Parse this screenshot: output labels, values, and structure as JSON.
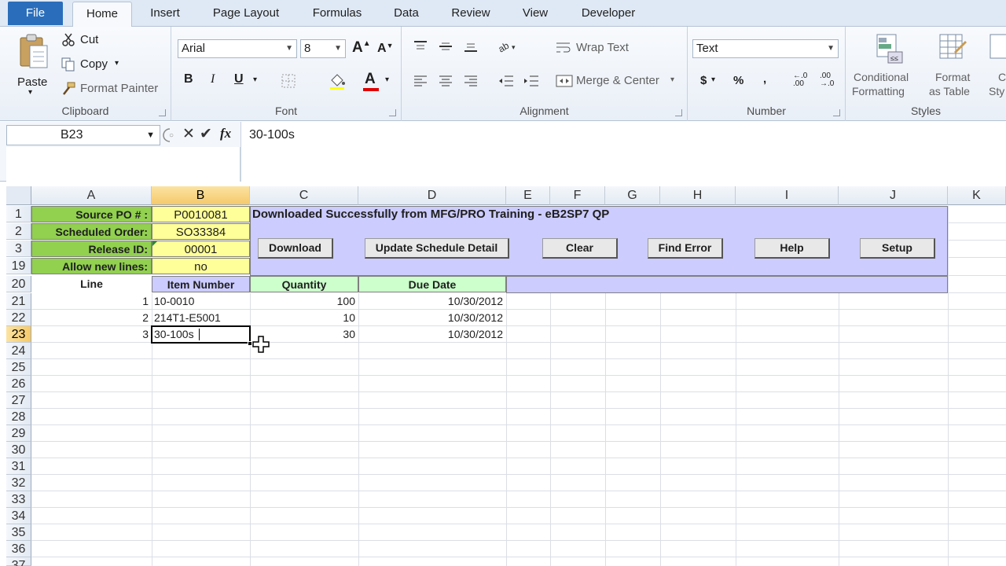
{
  "tabs": [
    {
      "label": "File"
    },
    {
      "label": "Home"
    },
    {
      "label": "Insert"
    },
    {
      "label": "Page Layout"
    },
    {
      "label": "Formulas"
    },
    {
      "label": "Data"
    },
    {
      "label": "Review"
    },
    {
      "label": "View"
    },
    {
      "label": "Developer"
    }
  ],
  "ribbon": {
    "clipboard": {
      "label": "Clipboard",
      "paste": "Paste",
      "cut": "Cut",
      "copy": "Copy",
      "format_painter": "Format Painter"
    },
    "font": {
      "label": "Font",
      "font_name": "Arial",
      "font_size": "8"
    },
    "alignment": {
      "label": "Alignment",
      "wrap_text": "Wrap Text",
      "merge_center": "Merge & Center"
    },
    "number": {
      "label": "Number",
      "format": "Text"
    },
    "styles": {
      "label": "Styles",
      "conditional_1": "Conditional",
      "conditional_2": "Formatting",
      "format_table_1": "Format",
      "format_table_2": "as Table",
      "cell_styles_1": "C",
      "cell_styles_2": "Sty"
    }
  },
  "formula_bar": {
    "name_box": "B23",
    "content": "30-100s"
  },
  "columns": [
    "A",
    "B",
    "C",
    "D",
    "E",
    "F",
    "G",
    "H",
    "I",
    "J",
    "K"
  ],
  "rows": [
    "1",
    "2",
    "3",
    "19",
    "20",
    "21",
    "22",
    "23",
    "24",
    "25",
    "26",
    "27",
    "28",
    "29",
    "30",
    "31",
    "32",
    "33",
    "34",
    "35",
    "36",
    "37"
  ],
  "sheet": {
    "labels": {
      "source_po": "Source PO # :",
      "scheduled_order": "Scheduled Order:",
      "release_id": "Release ID:",
      "allow_new_lines": "Allow new lines:"
    },
    "values": {
      "source_po": "P0010081",
      "scheduled_order": "SO33384",
      "release_id": "00001",
      "allow_new_lines": "no"
    },
    "status_message": "Downloaded Successfully from MFG/PRO Training - eB2SP7 QP",
    "buttons": [
      "Download",
      "Update Schedule Detail",
      "Clear",
      "Find Error",
      "Help",
      "Setup"
    ],
    "headers": {
      "line": "Line",
      "item_number": "Item Number",
      "quantity": "Quantity",
      "due_date": "Due Date"
    },
    "lines": [
      {
        "line": "1",
        "item": "10-0010",
        "qty": "100",
        "due": "10/30/2012"
      },
      {
        "line": "2",
        "item": "214T1-E5001",
        "qty": "10",
        "due": "10/30/2012"
      },
      {
        "line": "3",
        "item": "30-100s",
        "qty": "30",
        "due": "10/30/2012"
      }
    ]
  },
  "colors": {
    "label_green": "#92d050",
    "input_yellow": "#ffff99",
    "panel_lavender": "#ccccff",
    "header_green": "#ccffcc"
  }
}
